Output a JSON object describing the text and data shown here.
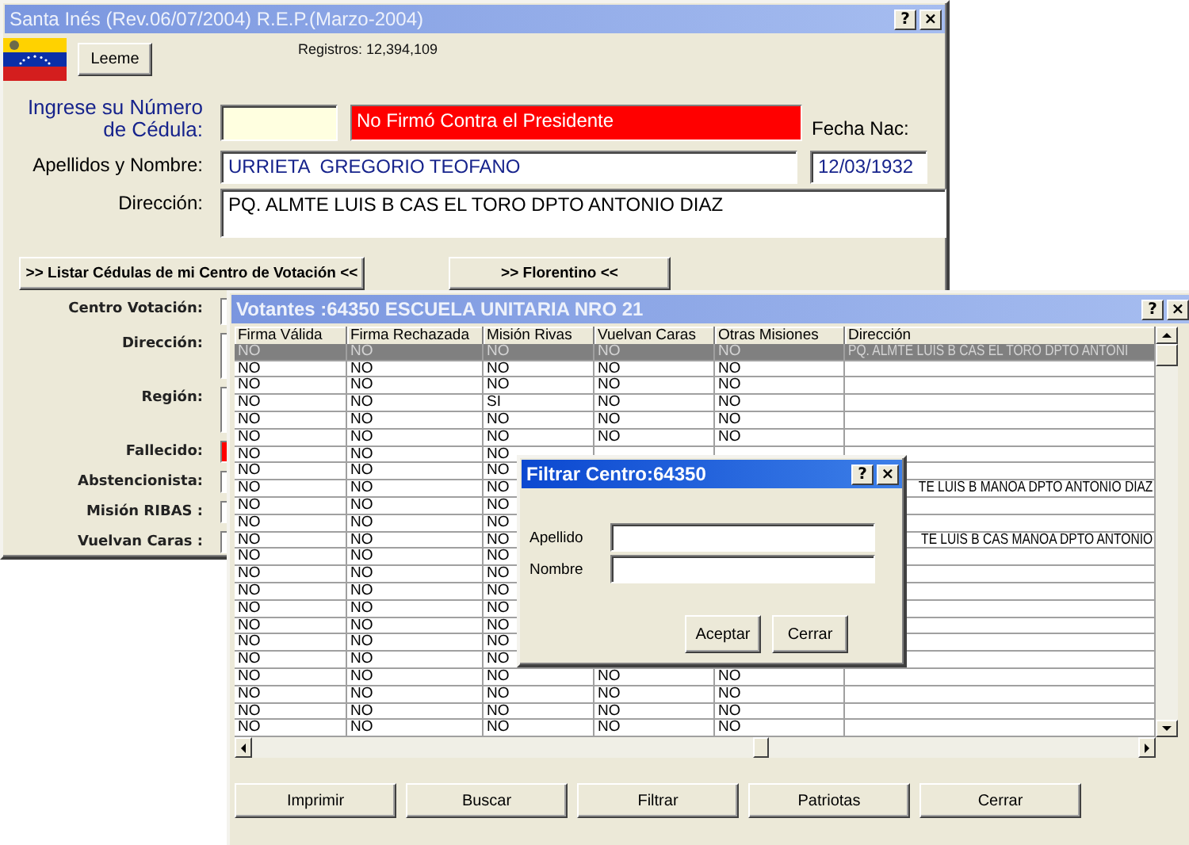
{
  "main_window": {
    "title": "Santa Inés (Rev.06/07/2004) R.E.P.(Marzo-2004)",
    "active": false,
    "help_button": "?",
    "close_button": "×",
    "readme_button": "Leeme",
    "records": "Registros: 12,394,109",
    "id_number": {
      "label": "Ingrese su Número de Cédula:"
    },
    "status": "No Firmó Contra el Presidente",
    "birth_date": {
      "label": "Fecha Nac:",
      "value": "12/03/1932"
    },
    "full_name": {
      "label": "Apellidos y Nombre:",
      "value": "URRIETA  GREGORIO TEOFANO"
    },
    "address": {
      "label": "Dirección:",
      "value": "PQ. ALMTE LUIS B CAS EL TORO DPTO ANTONIO DIAZ"
    },
    "action_buttons": [
      ">> Listar Cédulas de mi Centro de Votación <<",
      ">> Florentino <<"
    ],
    "details": [
      {
        "label": "Centro Votación:",
        "kind": "line",
        "highlight": false
      },
      {
        "label": "Dirección:",
        "kind": "multiline",
        "highlight": false
      },
      {
        "label": "Región:",
        "kind": "multiline",
        "highlight": false
      },
      {
        "label": "Fallecido:",
        "kind": "line",
        "highlight": true
      },
      {
        "label": "Abstencionista:",
        "kind": "line",
        "highlight": false
      },
      {
        "label": "Misión RIBAS :",
        "kind": "line",
        "highlight": false
      },
      {
        "label": "Vuelvan Caras :",
        "kind": "line",
        "highlight": false
      }
    ]
  },
  "voters_window": {
    "title": "Votantes :64350 ESCUELA UNITARIA NRO 21",
    "active": false,
    "help_button": "?",
    "close_button": "×",
    "table": {
      "columns": [
        "Firma Válida",
        "Firma Rechazada",
        "Misión Rivas",
        "Vuelvan Caras",
        "Otras Misiones",
        "Dirección"
      ],
      "rows": [
        {
          "selected": true,
          "firma_valida": "NO",
          "firma_rechazada": "NO",
          "mision_rivas": "NO",
          "vuelvan_caras": "NO",
          "otras_misiones": "NO",
          "direccion": "PQ. ALMTE LUIS B CAS EL TORO DPTO ANTONI"
        },
        {
          "selected": false,
          "firma_valida": "NO",
          "firma_rechazada": "NO",
          "mision_rivas": "NO",
          "vuelvan_caras": "NO",
          "otras_misiones": "NO"
        },
        {
          "selected": false,
          "firma_valida": "NO",
          "firma_rechazada": "NO",
          "mision_rivas": "NO",
          "vuelvan_caras": "NO",
          "otras_misiones": "NO"
        },
        {
          "selected": false,
          "firma_valida": "NO",
          "firma_rechazada": "NO",
          "mision_rivas": "SI",
          "vuelvan_caras": "NO",
          "otras_misiones": "NO"
        },
        {
          "selected": false,
          "firma_valida": "NO",
          "firma_rechazada": "NO",
          "mision_rivas": "NO",
          "vuelvan_caras": "NO",
          "otras_misiones": "NO"
        },
        {
          "selected": false,
          "firma_valida": "NO",
          "firma_rechazada": "NO",
          "mision_rivas": "NO",
          "vuelvan_caras": "NO",
          "otras_misiones": "NO"
        },
        {
          "selected": false,
          "firma_valida": "NO",
          "firma_rechazada": "NO",
          "mision_rivas": "NO"
        },
        {
          "selected": false,
          "firma_valida": "NO",
          "firma_rechazada": "NO",
          "mision_rivas": "NO"
        },
        {
          "selected": false,
          "firma_valida": "NO",
          "firma_rechazada": "NO",
          "mision_rivas": "NO",
          "direccion": "TE LUIS B MANOA DPTO ANTONIO DIAZ",
          "direccion_start_hidden": true
        },
        {
          "selected": false,
          "firma_valida": "NO",
          "firma_rechazada": "NO",
          "mision_rivas": "NO"
        },
        {
          "selected": false,
          "firma_valida": "NO",
          "firma_rechazada": "NO",
          "mision_rivas": "NO"
        },
        {
          "selected": false,
          "firma_valida": "NO",
          "firma_rechazada": "NO",
          "mision_rivas": "NO",
          "direccion": "TE LUIS B CAS MANOA DPTO ANTONIO",
          "direccion_start_hidden": true
        },
        {
          "selected": false,
          "firma_valida": "NO",
          "firma_rechazada": "NO",
          "mision_rivas": "NO"
        },
        {
          "selected": false,
          "firma_valida": "NO",
          "firma_rechazada": "NO",
          "mision_rivas": "NO"
        },
        {
          "selected": false,
          "firma_valida": "NO",
          "firma_rechazada": "NO",
          "mision_rivas": "NO"
        },
        {
          "selected": false,
          "firma_valida": "NO",
          "firma_rechazada": "NO",
          "mision_rivas": "NO"
        },
        {
          "selected": false,
          "firma_valida": "NO",
          "firma_rechazada": "NO",
          "mision_rivas": "NO"
        },
        {
          "selected": false,
          "firma_valida": "NO",
          "firma_rechazada": "NO",
          "mision_rivas": "NO"
        },
        {
          "selected": false,
          "firma_valida": "NO",
          "firma_rechazada": "NO",
          "mision_rivas": "NO"
        },
        {
          "selected": false,
          "firma_valida": "NO",
          "firma_rechazada": "NO",
          "mision_rivas": "NO",
          "vuelvan_caras": "NO",
          "otras_misiones": "NO"
        },
        {
          "selected": false,
          "firma_valida": "NO",
          "firma_rechazada": "NO",
          "mision_rivas": "NO",
          "vuelvan_caras": "NO",
          "otras_misiones": "NO"
        },
        {
          "selected": false,
          "firma_valida": "NO",
          "firma_rechazada": "NO",
          "mision_rivas": "NO",
          "vuelvan_caras": "NO",
          "otras_misiones": "NO"
        },
        {
          "selected": false,
          "firma_valida": "NO",
          "firma_rechazada": "NO",
          "mision_rivas": "NO",
          "vuelvan_caras": "NO",
          "otras_misiones": "NO"
        }
      ]
    },
    "buttons": [
      "Imprimir",
      "Buscar",
      "Filtrar",
      "Patriotas",
      "Cerrar"
    ]
  },
  "filter_dialog": {
    "title": "Filtrar Centro:64350",
    "active": true,
    "help_button": "?",
    "close_button": "×",
    "fields": [
      {
        "label": "Apellido"
      },
      {
        "label": "Nombre"
      }
    ],
    "buttons": [
      "Aceptar",
      "Cerrar"
    ]
  }
}
